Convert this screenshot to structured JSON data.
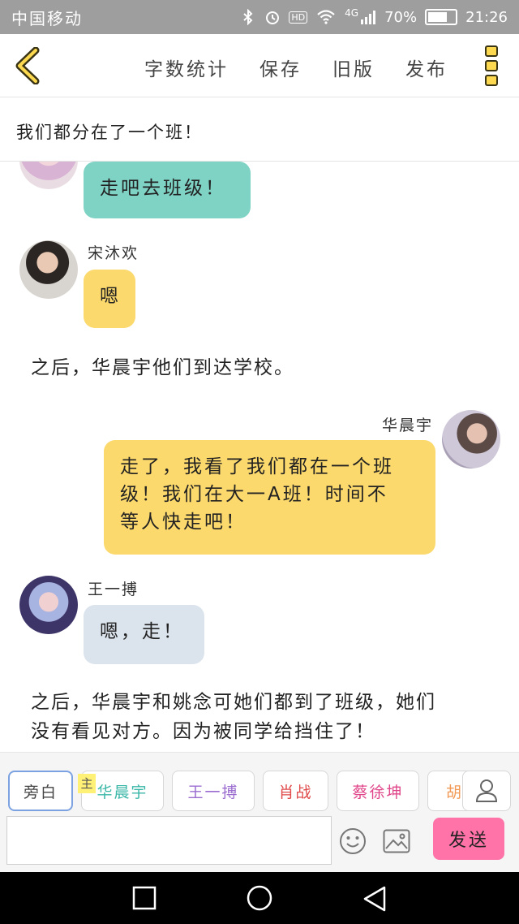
{
  "status_bar": {
    "carrier": "中国移动",
    "network": "4G",
    "battery": "70%",
    "battery_level": 0.7,
    "time": "21:26"
  },
  "top_bar": {
    "menu": [
      "字数统计",
      "保存",
      "旧版",
      "发布"
    ]
  },
  "chapter_title": "我们都分在了一个班！",
  "messages": {
    "m1": {
      "text": "走吧去班级！",
      "color": "#7fd3c5"
    },
    "m2": {
      "name": "宋沐欢",
      "text": "嗯",
      "color": "#fcd96c"
    },
    "n1": "之后，华晨宇他们到达学校。",
    "m3": {
      "name": "华晨宇",
      "lines": [
        "走了，我看了我们都在一个班",
        "级！我们在大一A班！时间不",
        "等人快走吧！"
      ],
      "color": "#fcd96c"
    },
    "m4": {
      "name": "王一搏",
      "text": "嗯，走！",
      "color": "#dbe3ec"
    },
    "n2": [
      "之后，华晨宇和姚念可她们都到了班级，她们",
      "没有看见对方。因为被同学给挡住了！"
    ]
  },
  "roles": {
    "narrator": "旁白",
    "main_tag": "主",
    "r1": {
      "label": "华晨宇",
      "color": "#3bb7a8"
    },
    "r2": {
      "label": "王一搏",
      "color": "#9b6cd0"
    },
    "r3": {
      "label": "肖战",
      "color": "#e04a4a"
    },
    "r4": {
      "label": "蔡徐坤",
      "color": "#e0458a"
    },
    "r5": {
      "label": "胡",
      "color": "#f29a55"
    }
  },
  "input": {
    "value": "",
    "placeholder": ""
  },
  "send_label": "发送",
  "icons": [
    "back-chevron-icon",
    "more-icon",
    "bluetooth-icon",
    "alarm-icon",
    "wifi-icon",
    "signal-icon",
    "battery-icon",
    "user-icon",
    "emoji-icon",
    "image-icon",
    "nav-recent-icon",
    "nav-home-icon",
    "nav-back-icon"
  ]
}
